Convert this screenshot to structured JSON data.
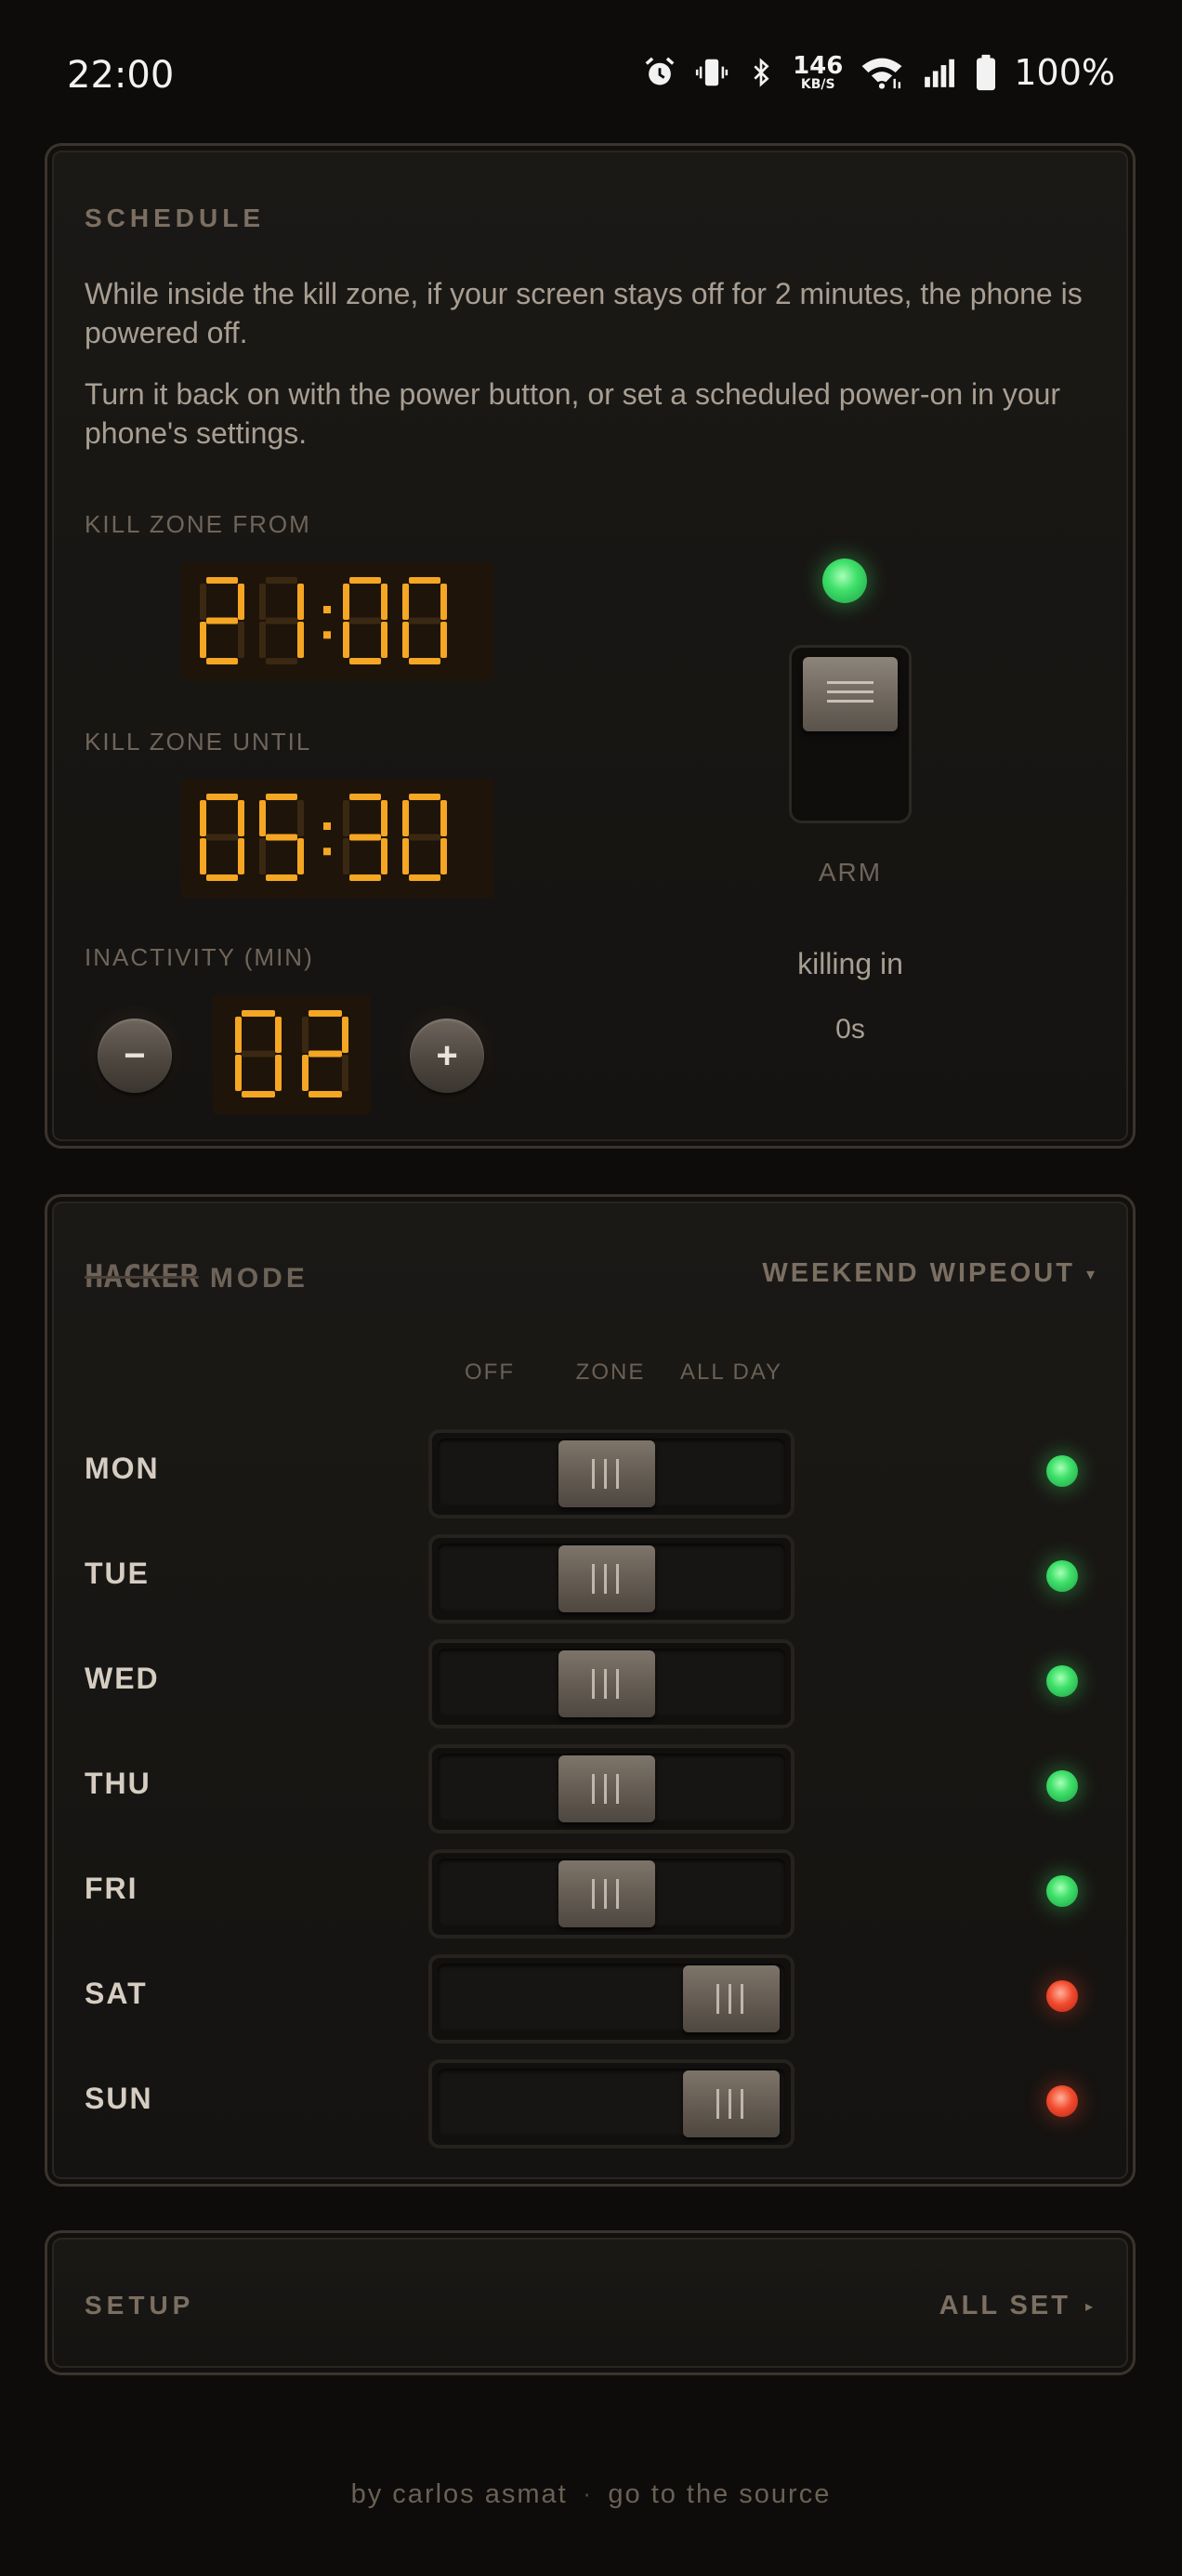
{
  "status_bar": {
    "time": "22:00",
    "net_speed_value": "146",
    "net_speed_unit": "KB/S",
    "battery": "100%",
    "icons": [
      "alarm-icon",
      "vibrate-icon",
      "bluetooth-icon",
      "wifi-icon",
      "signal-icon",
      "battery-icon"
    ]
  },
  "schedule": {
    "title": "SCHEDULE",
    "description_1": "While inside the kill zone, if your screen stays off for 2 minutes, the phone is powered off.",
    "description_2": "Turn it back on with the power button, or set a scheduled power-on in your phone's settings.",
    "from_label": "KILL ZONE FROM",
    "from_value": "21:00",
    "until_label": "KILL ZONE UNTIL",
    "until_value": "05:30",
    "inactivity_label": "INACTIVITY (MIN)",
    "inactivity_value": "02",
    "minus_label": "−",
    "plus_label": "+",
    "arm_label": "ARM",
    "arm_led": "on",
    "killing_label": "killing in",
    "killing_value": "0s"
  },
  "hacker_mode": {
    "title_glitch": "HACKER",
    "title_rest": "MODE",
    "preset": "WEEKEND WIPEOUT",
    "preset_caret": "▾",
    "columns": [
      "OFF",
      "ZONE",
      "ALL DAY"
    ],
    "days": [
      {
        "label": "MON",
        "mode": "ZONE",
        "led": "green"
      },
      {
        "label": "TUE",
        "mode": "ZONE",
        "led": "green"
      },
      {
        "label": "WED",
        "mode": "ZONE",
        "led": "green"
      },
      {
        "label": "THU",
        "mode": "ZONE",
        "led": "green"
      },
      {
        "label": "FRI",
        "mode": "ZONE",
        "led": "green"
      },
      {
        "label": "SAT",
        "mode": "ALL DAY",
        "led": "red"
      },
      {
        "label": "SUN",
        "mode": "ALL DAY",
        "led": "red"
      }
    ]
  },
  "setup": {
    "title": "SETUP",
    "status": "ALL SET",
    "caret": "▸"
  },
  "footer": {
    "author": "by carlos asmat",
    "separator": "·",
    "source_link": "go to the source"
  },
  "colors": {
    "segment_on": "#f5a623",
    "segment_off": "#3a2812",
    "led_green": "#3fe06a",
    "led_red": "#f24b2e"
  }
}
